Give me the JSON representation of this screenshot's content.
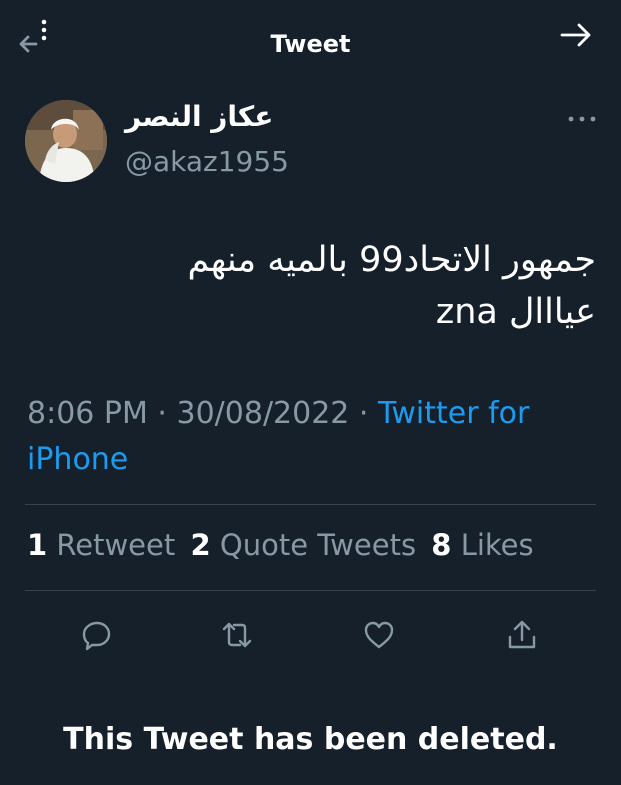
{
  "header": {
    "title": "Tweet"
  },
  "author": {
    "display_name": "عكاز النصر",
    "handle": "@akaz1955"
  },
  "tweet": {
    "text_line1": "جمهور الاتحاد99 بالميه منهم",
    "text_line2_rtl": "عيااال",
    "text_line2_ltr": "zna"
  },
  "meta": {
    "time_date": "8:06 PM · 30/08/2022 · ",
    "source": "Twitter for iPhone"
  },
  "stats": {
    "retweets_count": "1",
    "retweets_label": "Retweet",
    "quotes_count": "2",
    "quotes_label": "Quote Tweets",
    "likes_count": "8",
    "likes_label": "Likes"
  },
  "notice": {
    "text": "This Tweet has been deleted."
  },
  "icons": {
    "back": "back-arrow-icon",
    "forward": "forward-arrow-icon",
    "more": "more-dots-icon",
    "reply": "reply-icon",
    "retweet": "retweet-icon",
    "like": "heart-icon",
    "share": "share-icon"
  },
  "colors": {
    "background": "#15202b",
    "secondary_text": "#8899a6",
    "link": "#1d9bf0",
    "divider": "#38444d"
  }
}
